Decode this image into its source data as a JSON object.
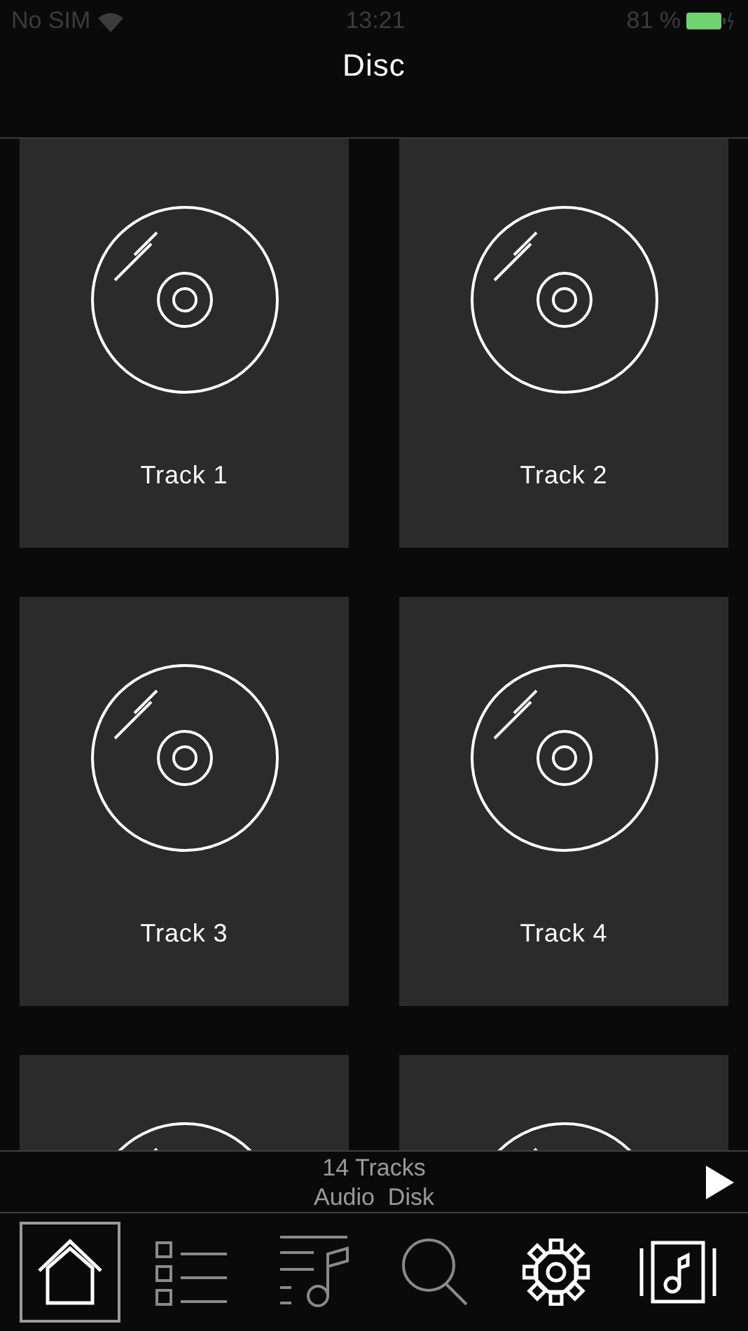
{
  "status_bar": {
    "carrier": "No SIM",
    "time": "13:21",
    "battery": "81 %"
  },
  "nav": {
    "title": "Disc"
  },
  "grid": [
    {
      "kind": "card",
      "label": "Track 1"
    },
    {
      "kind": "card",
      "label": "Track 2"
    },
    {
      "kind": "card",
      "label": "Track 3"
    },
    {
      "kind": "card",
      "label": "Track 4"
    },
    {
      "kind": "partial"
    },
    {
      "kind": "partial"
    }
  ],
  "player": {
    "line_1": "14 Tracks",
    "line_2": "Audio  Disk"
  },
  "tabs": [
    {
      "kind": "home",
      "selected": true,
      "disabled": false
    },
    {
      "kind": "list",
      "selected": false,
      "disabled": true
    },
    {
      "kind": "playlist",
      "selected": false,
      "disabled": true
    },
    {
      "kind": "search",
      "selected": false,
      "disabled": true
    },
    {
      "kind": "settings",
      "selected": false,
      "disabled": false
    },
    {
      "kind": "album",
      "selected": false,
      "disabled": false
    }
  ]
}
